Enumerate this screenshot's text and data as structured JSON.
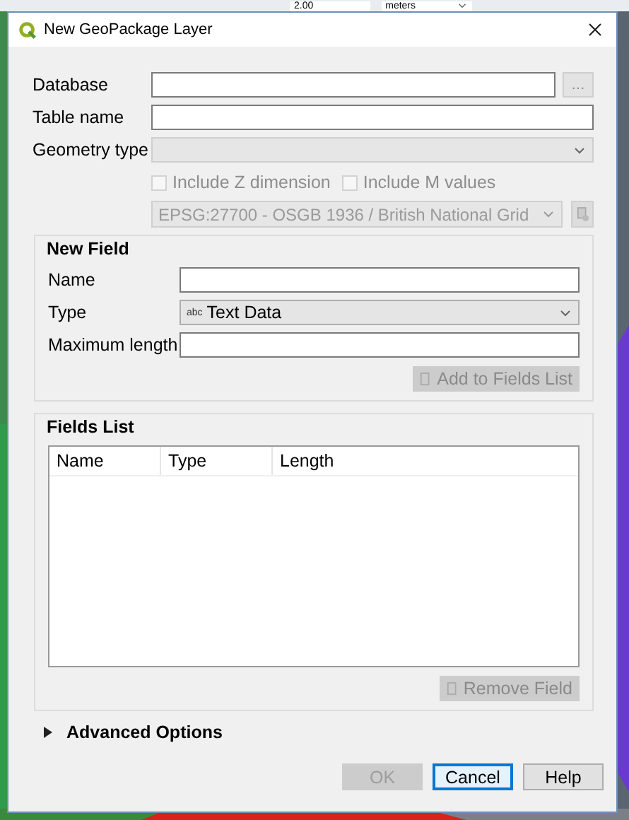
{
  "background": {
    "toolbar": [
      {
        "kind": "field",
        "text": "2.00"
      },
      {
        "kind": "dropdown",
        "text": "meters"
      }
    ]
  },
  "window": {
    "title": "New GeoPackage Layer"
  },
  "form": {
    "rows": [
      {
        "label": "Database",
        "kind": "text",
        "browse": "…"
      },
      {
        "label": "Table name",
        "kind": "text"
      },
      {
        "label": "Geometry type",
        "kind": "select",
        "disabled": true
      }
    ]
  },
  "options": [
    {
      "label": "Include Z dimension",
      "checked": false,
      "disabled": true
    },
    {
      "label": "Include M values",
      "checked": false,
      "disabled": true
    }
  ],
  "crs": {
    "value": "EPSG:27700 - OSGB 1936 / British National Grid",
    "disabled": true
  },
  "new_field": {
    "title": "New Field",
    "rows": [
      {
        "label": "Name",
        "kind": "text"
      },
      {
        "label": "Type",
        "kind": "select",
        "icon": "abc",
        "value": "Text Data"
      },
      {
        "label": "Maximum length",
        "kind": "text"
      }
    ],
    "add_button": {
      "label": "Add to Fields List",
      "disabled": true
    }
  },
  "fields_list": {
    "title": "Fields List",
    "columns": [
      "Name",
      "Type",
      "Length"
    ],
    "remove_button": {
      "label": "Remove Field",
      "disabled": true
    }
  },
  "advanced": {
    "label": "Advanced Options",
    "expanded": false
  },
  "buttons": [
    {
      "label": "OK",
      "disabled": true,
      "focused": false
    },
    {
      "label": "Cancel",
      "disabled": false,
      "focused": true
    },
    {
      "label": "Help",
      "disabled": false,
      "focused": false
    }
  ]
}
